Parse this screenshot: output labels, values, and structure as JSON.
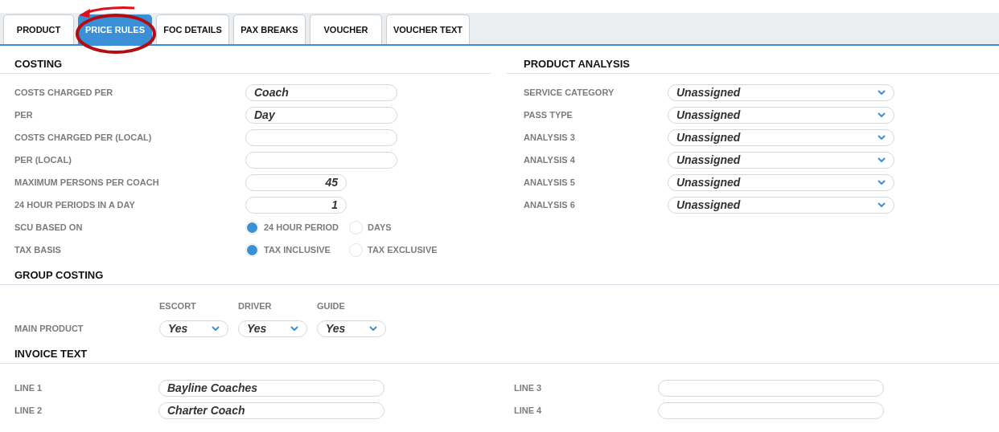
{
  "tabs": [
    {
      "label": "PRODUCT",
      "selected": false
    },
    {
      "label": "PRICE RULES",
      "selected": true
    },
    {
      "label": "FOC DETAILS",
      "selected": false
    },
    {
      "label": "PAX BREAKS",
      "selected": false
    },
    {
      "label": "VOUCHER",
      "selected": false
    },
    {
      "label": "VOUCHER TEXT",
      "selected": false
    }
  ],
  "costing": {
    "title": "COSTING",
    "fields": [
      {
        "kind": "text",
        "label": "COSTS CHARGED PER",
        "value": "Coach"
      },
      {
        "kind": "text",
        "label": "PER",
        "value": "Day"
      },
      {
        "kind": "text",
        "label": "COSTS CHARGED PER (LOCAL)"
      },
      {
        "kind": "text",
        "label": "PER (LOCAL)"
      },
      {
        "kind": "number",
        "label": "MAXIMUM PERSONS PER COACH",
        "value": "45"
      },
      {
        "kind": "number",
        "label": "24 HOUR PERIODS IN A DAY",
        "value": "1"
      },
      {
        "kind": "radio",
        "label": "SCU BASED ON",
        "options": [
          {
            "label": "24 HOUR PERIOD",
            "selected": true
          },
          {
            "label": "DAYS",
            "selected": false
          }
        ]
      },
      {
        "kind": "radio",
        "label": "TAX BASIS",
        "options": [
          {
            "label": "TAX INCLUSIVE",
            "selected": true
          },
          {
            "label": "TAX EXCLUSIVE",
            "selected": false
          }
        ]
      }
    ]
  },
  "product_analysis": {
    "title": "PRODUCT ANALYSIS",
    "fields": [
      {
        "label": "SERVICE CATEGORY",
        "value": "Unassigned"
      },
      {
        "label": "PASS TYPE",
        "value": "Unassigned"
      },
      {
        "label": "ANALYSIS 3",
        "value": "Unassigned"
      },
      {
        "label": "ANALYSIS 4",
        "value": "Unassigned"
      },
      {
        "label": "ANALYSIS 5",
        "value": "Unassigned"
      },
      {
        "label": "ANALYSIS 6",
        "value": "Unassigned"
      }
    ]
  },
  "group_costing": {
    "title": "GROUP COSTING",
    "columns": [
      "ESCORT",
      "DRIVER",
      "GUIDE"
    ],
    "rows": [
      {
        "label": "MAIN PRODUCT",
        "values": [
          "Yes",
          "Yes",
          "Yes"
        ]
      }
    ]
  },
  "invoice_text": {
    "title": "INVOICE TEXT",
    "left": [
      {
        "label": "LINE 1",
        "value": "Bayline Coaches"
      },
      {
        "label": "LINE 2",
        "value": "Charter Coach"
      }
    ],
    "right": [
      {
        "label": "LINE 3"
      },
      {
        "label": "LINE 4"
      }
    ]
  }
}
